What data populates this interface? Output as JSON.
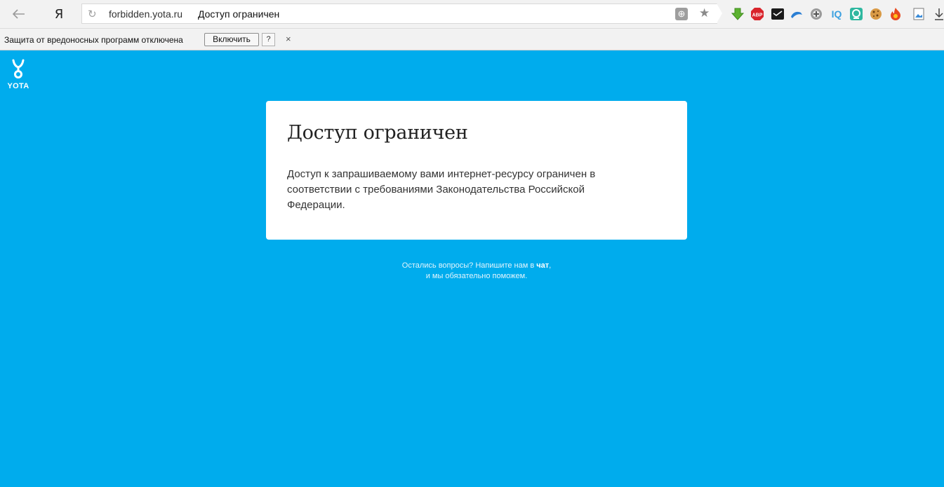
{
  "browser": {
    "logo": "Я",
    "url": "forbidden.yota.ru",
    "page_title": "Доступ ограничен",
    "extensions": [
      "download-icon",
      "adblock-icon",
      "steam-icon",
      "cloud-icon",
      "plus-icon",
      "iq-icon",
      "camera-icon",
      "cookie-icon",
      "fire-icon",
      "image-icon"
    ],
    "extension_labels": {
      "adblock": "ABP",
      "iq": "IQ"
    }
  },
  "infobar": {
    "message": "Защита от вредоносных программ отключена",
    "enable_label": "Включить",
    "help_label": "?",
    "close_label": "×"
  },
  "page": {
    "logo_text": "YOTA",
    "card_title": "Доступ ограничен",
    "card_text": "Доступ к запрашиваемому вами интернет-ресурсу ограничен в соответствии с требованиями Законодательства Российской Федерации.",
    "help_line1": "Остались вопросы? Напишите нам в",
    "help_link": "чат",
    "help_line2": "и мы обязательно поможем."
  },
  "colors": {
    "background": "#00aced",
    "card": "#ffffff"
  }
}
